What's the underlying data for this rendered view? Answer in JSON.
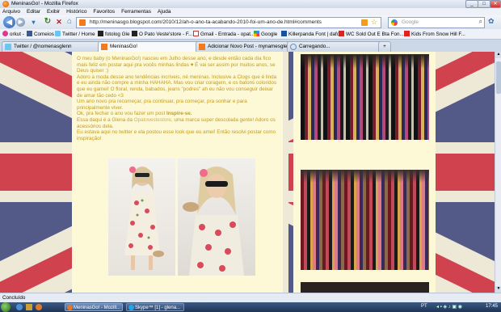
{
  "window": {
    "title": "MeninasGo! - Mozilla Firefox",
    "min": "_",
    "max": "□",
    "close": "✕"
  },
  "menu": [
    "Arquivo",
    "Editar",
    "Exibir",
    "Histórico",
    "Favoritos",
    "Ferramentas",
    "Ajuda"
  ],
  "address": {
    "url": "http://meninasgo.blogspot.com/2010/12/ah-o-ano-ta-acabando-2010-foi-um-ano-de.html#comments"
  },
  "search": {
    "placeholder": "Google"
  },
  "bookmarks": [
    "orkut -",
    "Comeios",
    "Twitter / Home",
    "fotolog Gle",
    "O Pato Veste'store - F...",
    "Gmail - Entrada - opat...",
    "Google",
    "Killerpanda Font | dafo...",
    "WC Sold Out E Bta Fon...",
    "Kids From Snow Hill F..."
  ],
  "tabs": [
    {
      "label": "Twitter / @nomenasglenn",
      "active": false
    },
    {
      "label": "MeninasGo!",
      "active": true
    },
    {
      "label": "Adicionar Novo Post - mynamesglenn...",
      "active": false
    },
    {
      "label": "Carregando...",
      "active": false
    }
  ],
  "post": {
    "p1": "O meu baby (o MeninasGo!) nasceu em Julho desse ano, e desde então cada dia fico mais feliz em postar aqui pra vocês minhas lindas ♥ É vai ser assim por muitos anos, se Deus quiser :)",
    "p2": "Adoro a moda desse ano tendências incríveis, né meninas. Inclusive a Clogs que é linda e eu ainda não compre a minha HAHAHA. Mas vou criar coragem, e os batons coloridos que eu gamei! O floral, renda, babados, jeans \"podres\" ah eu não vou conseguir deixar de amar tão cedo <3",
    "p3": "Um ano novo pra recomeçar, pra continuar, pra começar, pra sonhar e para principalmente viver.",
    "p4a": "Ok, pra fechar o ano vou fazer um post ",
    "p4b": "Inspire-se.",
    "p5a": "Essa daqui é a Glena da ",
    "p5b": "Opatovestestore",
    "p5c": ", uma marca super descolada gente! Adoro os acessórios dela.",
    "p6": "Eu estava aqui no twitter e ela postou esse look que eu amei! Então resolvi postar como inspiração!"
  },
  "status": {
    "text": "Concluído"
  },
  "taskbar": {
    "items": [
      "MeninasGo! - Mozill...",
      "Skype™ [1] - glena..."
    ],
    "lang": "PT",
    "time": "17:45"
  },
  "colors": {
    "post_text": "#c49a1a",
    "page_bg": "#fdf9d6",
    "flag_red": "#c8102e",
    "flag_blue": "#1f2a6d"
  }
}
